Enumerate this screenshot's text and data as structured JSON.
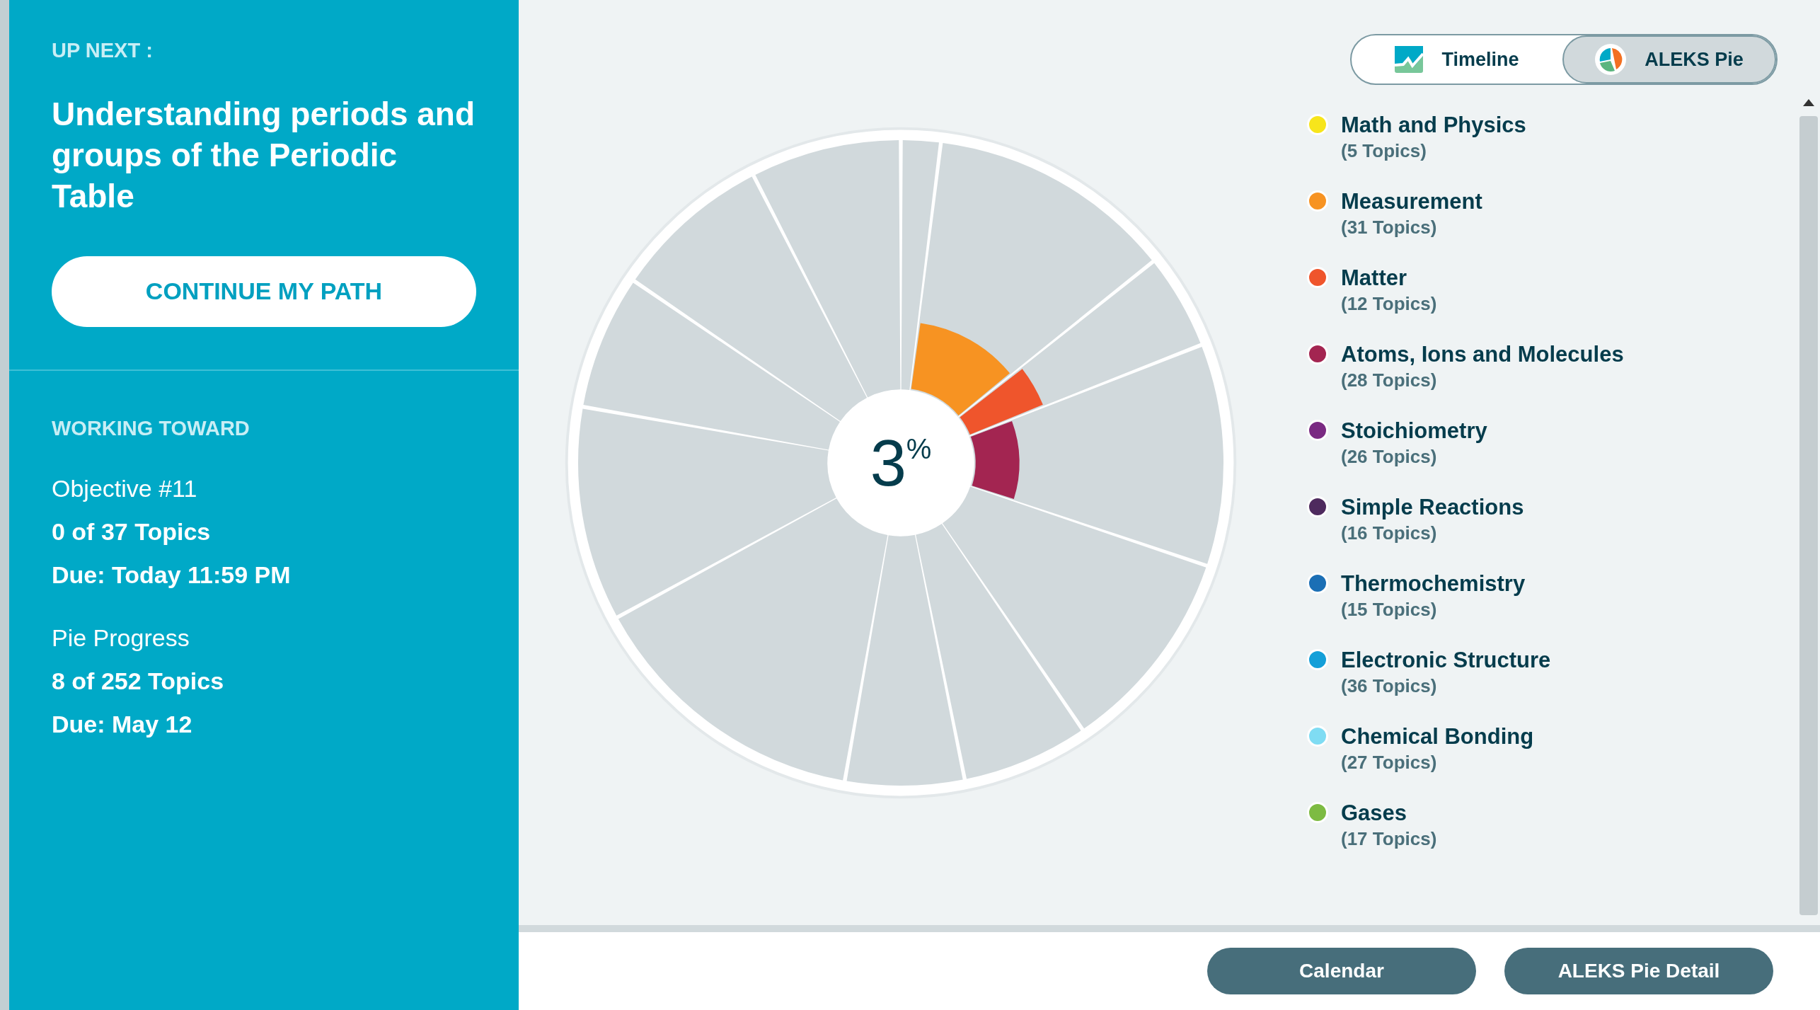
{
  "up_next": {
    "label": "UP NEXT :",
    "title": "Understanding periods and groups of the Periodic Table",
    "button": "CONTINUE MY PATH"
  },
  "working_toward": {
    "label": "WORKING TOWARD",
    "objective": {
      "name": "Objective #11",
      "topics": "0 of 37 Topics",
      "due": "Due: Today 11:59 PM"
    },
    "pie_progress": {
      "name": "Pie Progress",
      "topics": "8 of 252 Topics",
      "due": "Due: May 12"
    }
  },
  "view_toggle": [
    {
      "label": "Timeline",
      "kind": "timeline",
      "selected": false
    },
    {
      "label": "ALEKS Pie",
      "kind": "pie",
      "selected": true
    }
  ],
  "pie": {
    "percent": "3",
    "percent_sign": "%"
  },
  "topics": [
    {
      "name": "Math and Physics",
      "count": "(5 Topics)",
      "color": "#f7e51b"
    },
    {
      "name": "Measurement",
      "count": "(31 Topics)",
      "color": "#f79322"
    },
    {
      "name": "Matter",
      "count": "(12 Topics)",
      "color": "#ef552c"
    },
    {
      "name": "Atoms, Ions and Molecules",
      "count": "(28 Topics)",
      "color": "#a32551"
    },
    {
      "name": "Stoichiometry",
      "count": "(26 Topics)",
      "color": "#7a2a82"
    },
    {
      "name": "Simple Reactions",
      "count": "(16 Topics)",
      "color": "#4e2a5e"
    },
    {
      "name": "Thermochemistry",
      "count": "(15 Topics)",
      "color": "#1b6fb5"
    },
    {
      "name": "Electronic Structure",
      "count": "(36 Topics)",
      "color": "#149fd8"
    },
    {
      "name": "Chemical Bonding",
      "count": "(27 Topics)",
      "color": "#7fdcf3"
    },
    {
      "name": "Gases",
      "count": "(17 Topics)",
      "color": "#7dbb42"
    }
  ],
  "footer_buttons": [
    "Calendar",
    "ALEKS Pie Detail"
  ]
}
